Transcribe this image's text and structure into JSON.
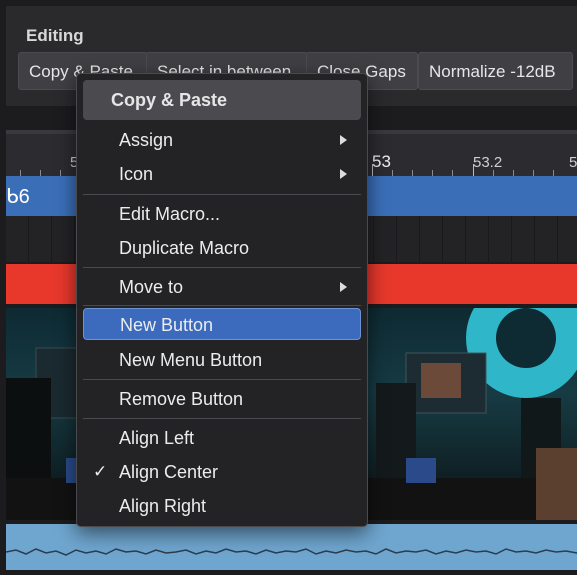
{
  "panel": {
    "title": "Editing",
    "buttons": [
      {
        "label": "Copy & Paste"
      },
      {
        "label": "Select in between"
      },
      {
        "label": "Close Gaps"
      },
      {
        "label": "Normalize -12dB"
      }
    ]
  },
  "timeline": {
    "ruler_labels": [
      "5",
      "53",
      "53.2",
      "5"
    ],
    "track_label": "ᑲ6"
  },
  "context_menu": {
    "header": "Copy & Paste",
    "items": {
      "assign": "Assign",
      "icon": "Icon",
      "edit_macro": "Edit Macro...",
      "duplicate_macro": "Duplicate Macro",
      "move_to": "Move to",
      "new_button": "New Button",
      "new_menu_button": "New Menu Button",
      "remove_button": "Remove Button",
      "align_left": "Align Left",
      "align_center": "Align Center",
      "align_right": "Align Right"
    },
    "check_mark": "✓",
    "selected_item": "New Button",
    "checked_item": "Align Center"
  },
  "colors": {
    "accent_selected": "#3c6bbd",
    "track_blue": "#3a6fb8",
    "track_red": "#e8382c",
    "audio": "#6fa6cf"
  }
}
